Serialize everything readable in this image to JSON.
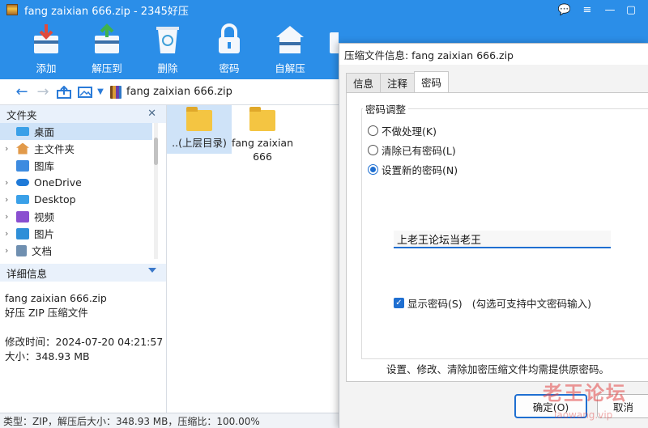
{
  "window": {
    "title": "fang zaixian 666.zip - 2345好压"
  },
  "toolbar": {
    "items": [
      {
        "label": "添加",
        "icon": "add-icon"
      },
      {
        "label": "解压到",
        "icon": "extract-icon"
      },
      {
        "label": "删除",
        "icon": "delete-icon"
      },
      {
        "label": "密码",
        "icon": "lock-icon"
      },
      {
        "label": "自解压",
        "icon": "self-extract-icon"
      }
    ],
    "brand": "好压"
  },
  "address": {
    "path": "fang zaixian 666.zip"
  },
  "sidebar": {
    "header": "文件夹",
    "items": [
      {
        "label": "桌面",
        "icon": "desktop-icon",
        "selected": true
      },
      {
        "label": "主文件夹",
        "icon": "home-icon"
      },
      {
        "label": "图库",
        "icon": "gallery-icon"
      },
      {
        "label": "OneDrive",
        "icon": "cloud-icon"
      },
      {
        "label": "Desktop",
        "icon": "folder-icon"
      },
      {
        "label": "视频",
        "icon": "video-icon"
      },
      {
        "label": "图片",
        "icon": "pictures-icon"
      },
      {
        "label": "文档",
        "icon": "documents-icon"
      }
    ]
  },
  "details": {
    "header": "详细信息",
    "filename": "fang zaixian 666.zip",
    "filetype": "好压 ZIP 压缩文件",
    "modified": "修改时间：2024-07-20 04:21:57",
    "size": "大小：348.93 MB"
  },
  "files": [
    {
      "name": "..(上层目录)"
    },
    {
      "name": "fang zaixian 666"
    }
  ],
  "status": {
    "text": "类型：ZIP，解压后大小：348.93 MB，压缩比：100.00%"
  },
  "dialog": {
    "title": "压缩文件信息: fang zaixian 666.zip",
    "tabs": [
      "信息",
      "注释",
      "密码"
    ],
    "group_title": "密码调整",
    "options": [
      "不做处理(K)",
      "清除已有密码(L)",
      "设置新的密码(N)"
    ],
    "password_value": "上老王论坛当老王",
    "show_password_label": "显示密码(S)",
    "show_password_note": "(勾选可支持中文密码输入)",
    "note": "设置、修改、清除加密压缩文件均需提供原密码。",
    "ok_label": "确定(O)",
    "cancel_label": "取消"
  },
  "watermark": {
    "text": "老王论坛",
    "url": "laowang.vip"
  },
  "colors": {
    "accent": "#2b8ee8",
    "selection": "#cfe3f8",
    "focus": "#1f6fd1"
  }
}
